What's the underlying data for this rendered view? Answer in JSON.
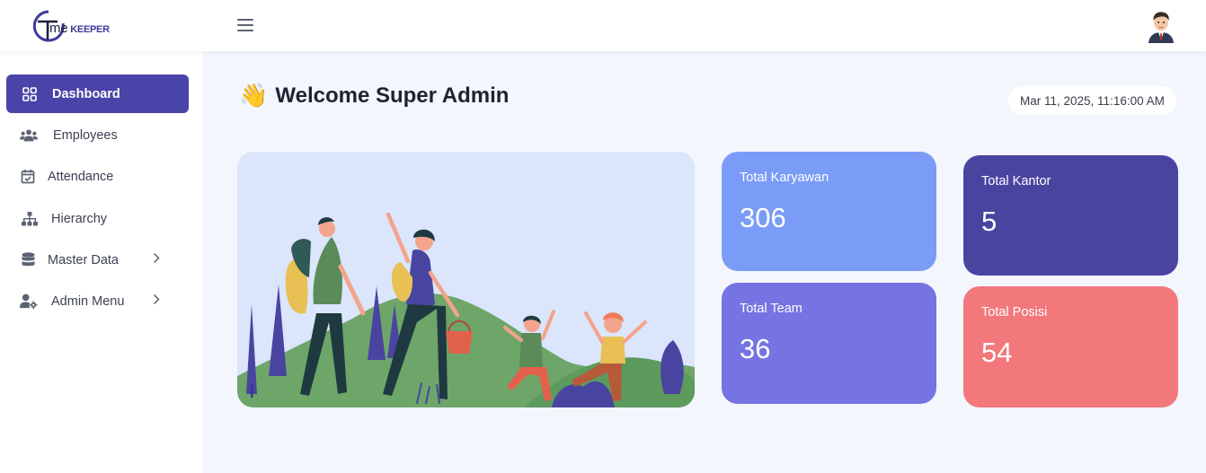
{
  "header": {
    "logo": {
      "text_main": "ime",
      "text_sub": "KEEPER",
      "initial": "T"
    },
    "menu_icon": "hamburger-icon",
    "avatar_icon": "user-avatar"
  },
  "sidebar": {
    "items": [
      {
        "label": "Dashboard",
        "icon": "grid-icon",
        "active": true
      },
      {
        "label": "Employees",
        "icon": "users-icon"
      },
      {
        "label": "Attendance",
        "icon": "calendar-check-icon"
      },
      {
        "label": "Hierarchy",
        "icon": "hierarchy-icon"
      },
      {
        "label": "Master Data",
        "icon": "database-icon",
        "has_submenu": true
      },
      {
        "label": "Admin Menu",
        "icon": "user-gear-icon",
        "has_submenu": true
      }
    ]
  },
  "main": {
    "welcome_emoji": "👋",
    "welcome_text": "Welcome Super Admin",
    "datetime": "Mar 11, 2025, 11:16:00 AM",
    "stats": [
      {
        "title": "Total Karyawan",
        "value": "306",
        "color": "#7a9cf6"
      },
      {
        "title": "Total Kantor",
        "value": "5",
        "color": "#4a44a1"
      },
      {
        "title": "Total Team",
        "value": "36",
        "color": "#7574e2"
      },
      {
        "title": "Total Posisi",
        "value": "54",
        "color": "#f2787c"
      }
    ]
  },
  "colors": {
    "accent": "#4a44a8",
    "background": "#f3f6fd"
  }
}
